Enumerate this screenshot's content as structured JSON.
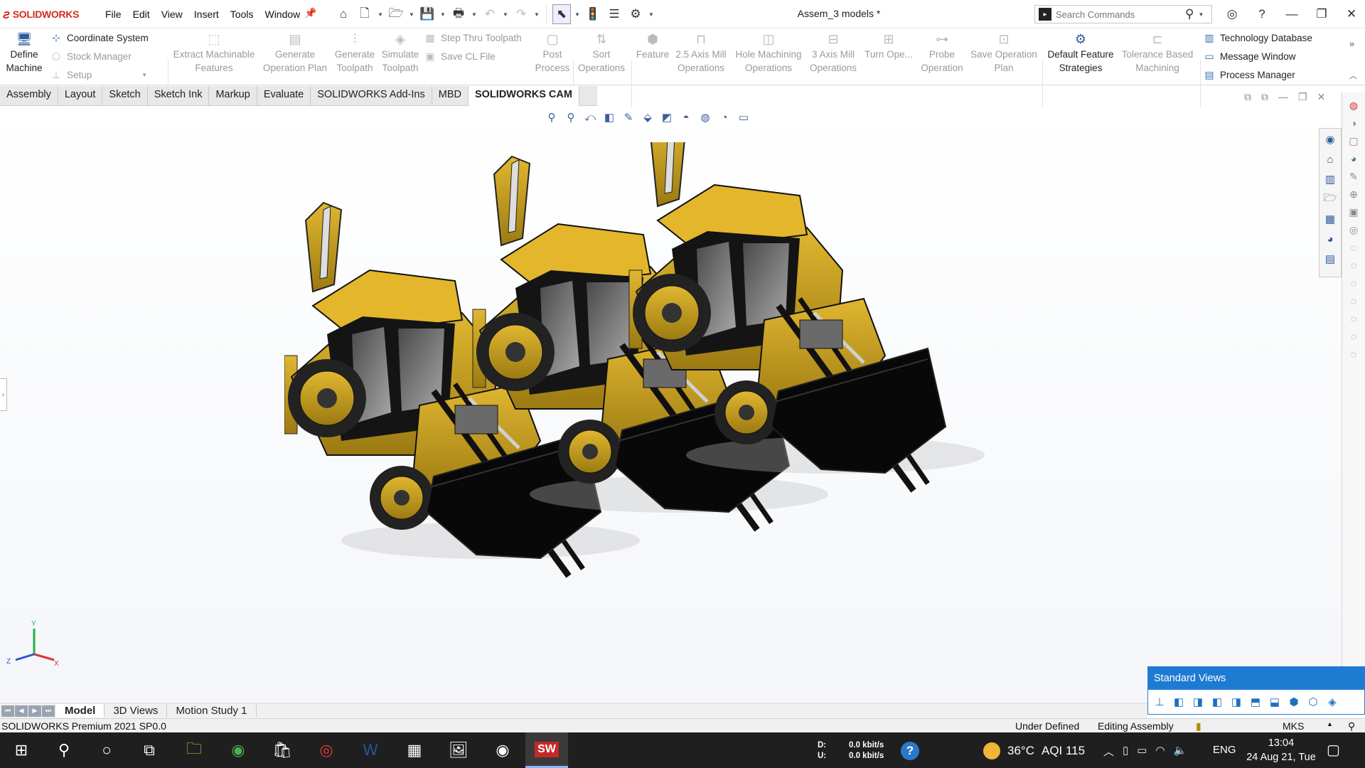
{
  "app": {
    "name": "SOLIDWORKS",
    "document_title": "Assem_3 models *"
  },
  "menu": [
    "File",
    "Edit",
    "View",
    "Insert",
    "Tools",
    "Window"
  ],
  "search": {
    "placeholder": "Search Commands"
  },
  "command_manager": {
    "define_machine": "Define Machine",
    "coordinate_system": "Coordinate System",
    "stock_manager": "Stock Manager",
    "setup": "Setup",
    "extract_machinable_features": "Extract Machinable Features",
    "generate_operation_plan": "Generate Operation Plan",
    "generate_toolpath": "Generate Toolpath",
    "simulate_toolpath": "Simulate Toolpath",
    "step_thru_toolpath": "Step Thru Toolpath",
    "save_cl_file": "Save CL File",
    "post_process": "Post Process",
    "sort_operations": "Sort Operations",
    "feature": "Feature",
    "axis25_mill": "2.5 Axis Mill Operations",
    "hole_machining": "Hole Machining Operations",
    "axis3_mill": "3 Axis Mill Operations",
    "turn_ope": "Turn Ope...",
    "probe_operation": "Probe Operation",
    "save_operation_plan": "Save Operation Plan",
    "default_feature_strategies": "Default Feature Strategies",
    "tolerance_based_machining": "Tolerance Based Machining",
    "technology_database": "Technology Database",
    "message_window": "Message Window",
    "process_manager": "Process Manager"
  },
  "ribbon_tabs": [
    "Assembly",
    "Layout",
    "Sketch",
    "Sketch Ink",
    "Markup",
    "Evaluate",
    "SOLIDWORKS Add-Ins",
    "MBD",
    "SOLIDWORKS CAM"
  ],
  "active_ribbon_tab": "SOLIDWORKS CAM",
  "triad_labels": {
    "y": "Y",
    "x": "X",
    "z": "Z"
  },
  "standard_views": {
    "title": "Standard Views"
  },
  "model_tabs": [
    "Model",
    "3D Views",
    "Motion Study 1"
  ],
  "status_bar": {
    "product": "SOLIDWORKS Premium 2021 SP0.0",
    "definition": "Under Defined",
    "mode": "Editing Assembly",
    "units": "MKS"
  },
  "taskbar": {
    "net_down_label": "D:",
    "net_down_value": "0.0 kbit/s",
    "net_up_label": "U:",
    "net_up_value": "0.0 kbit/s",
    "temperature": "36°C",
    "aqi": "AQI 115",
    "language": "ENG",
    "time": "13:04",
    "date": "24 Aug 21, Tue"
  },
  "colors": {
    "accent": "#1e7bd2",
    "loader_yellow": "#c9a51e",
    "brand_red": "#d52b1e"
  }
}
